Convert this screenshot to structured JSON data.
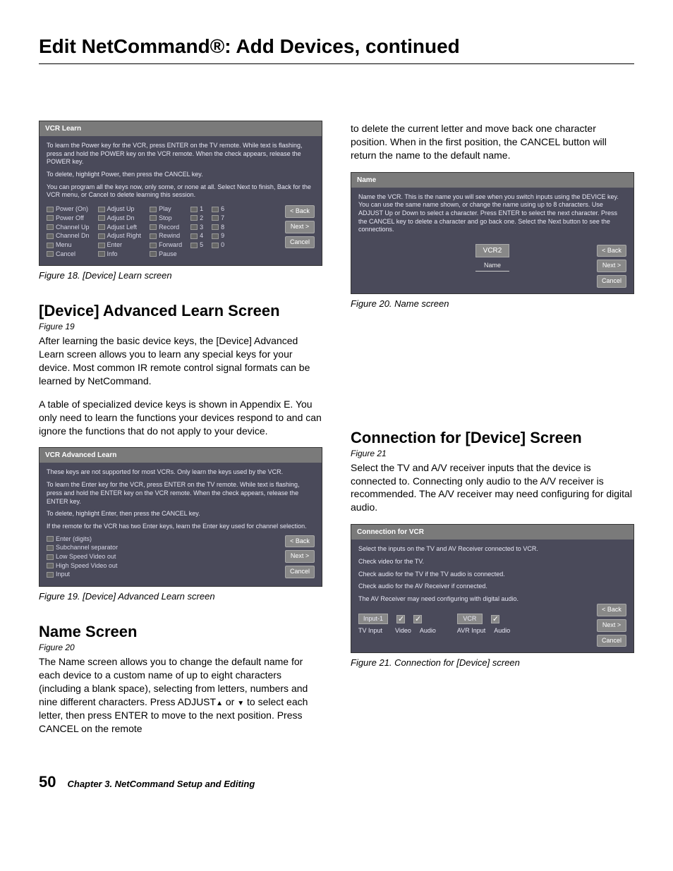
{
  "pageTitle": "Edit NetCommand®:  Add Devices, continued",
  "fig18": {
    "header": "VCR Learn",
    "instr1": "To learn the Power key for the VCR, press ENTER on the TV remote. While text is flashing, press and hold the POWER key on the VCR remote. When the check appears, release the POWER key.",
    "instr2": "To delete, highlight Power, then press the CANCEL key.",
    "instr3": "You can program all the keys now, only some, or none at all. Select Next to finish, Back for the VCR menu, or Cancel to delete learning this session.",
    "keysCol1": [
      "Power (On)",
      "Power Off",
      "Channel Up",
      "Channel Dn",
      "Menu",
      "Cancel"
    ],
    "keysCol2": [
      "Adjust Up",
      "Adjust Dn",
      "Adjust Left",
      "Adjust Right",
      "Enter",
      "Info"
    ],
    "keysCol3": [
      "Play",
      "Stop",
      "Record",
      "Rewind",
      "Forward",
      "Pause"
    ],
    "keysCol4": [
      "1",
      "2",
      "3",
      "4",
      "5"
    ],
    "keysCol5": [
      "6",
      "7",
      "8",
      "9",
      "0"
    ],
    "btnBack": "< Back",
    "btnNext": "Next >",
    "btnCancel": "Cancel",
    "caption": "Figure 18.  [Device] Learn screen"
  },
  "sectionAdvanced": {
    "title": "[Device] Advanced Learn Screen",
    "figref": "Figure 19",
    "p1": "After learning the basic device keys, the [Device] Advanced Learn screen allows you to learn any special keys for your device.  Most common IR remote control signal formats can be learned by NetCommand.",
    "p2": "A table of specialized device keys is shown in Appendix E. You only need to learn the functions your devices respond to and can ignore the functions that do not apply to your device."
  },
  "fig19": {
    "header": "VCR Advanced Learn",
    "instr1": "These keys are not supported for most VCRs. Only learn the keys used by the VCR.",
    "instr2": "To learn the Enter key for the VCR, press ENTER on the TV remote. While text is flashing, press and hold the ENTER key on the VCR remote. When the check appears, release the ENTER key.",
    "instr3": "To delete, highlight Enter, then press the CANCEL key.",
    "instr4": "If the remote for the VCR has two Enter keys, learn the Enter key used for channel selection.",
    "keys": [
      "Enter (digits)",
      "Subchannel separator",
      "Low Speed Video out",
      "High Speed Video out",
      "Input"
    ],
    "btnBack": "< Back",
    "btnNext": "Next >",
    "btnCancel": "Cancel",
    "caption": "Figure 19.  [Device] Advanced Learn screen"
  },
  "sectionName": {
    "title": "Name Screen",
    "figref": "Figure 20",
    "p1a": "The Name screen allows you to change the default name for each device to a custom name of up to eight characters (including a blank space), selecting from letters, numbers and nine different characters.  Press ADJUST",
    "p1b": " or ",
    "p1c": " to select each letter, then press ENTER to move to the next position.  Press CANCEL on the remote"
  },
  "rightTop": {
    "p": "to delete the current letter and move back one character position.  When in the first position, the CANCEL button will return the name to the default name."
  },
  "fig20": {
    "header": "Name",
    "instr": "Name the VCR.  This is the name you will see when you switch inputs using the DEVICE key.  You can use the same name shown, or change the name using up to 8 characters. Use ADJUST Up or Down to select a character.  Press ENTER to select the next character.  Press the CANCEL key to delete a character and go back one.  Select the Next button to see the connections.",
    "nameValue": "VCR2",
    "nameLabel": "Name",
    "btnBack": "< Back",
    "btnNext": "Next >",
    "btnCancel": "Cancel",
    "caption": "Figure 20.  Name screen"
  },
  "sectionConn": {
    "title": "Connection for [Device] Screen",
    "figref": "Figure 21",
    "p1": "Select the TV and A/V receiver inputs that the device is connected to.  Connecting only audio to the A/V receiver is recommended.  The A/V receiver may need configuring for digital audio."
  },
  "fig21": {
    "header": "Connection for VCR",
    "instr1": "Select the inputs on the TV and AV Receiver connected to VCR.",
    "instr2": "Check video for the TV.",
    "instr3": "Check audio for the TV if the TV audio is connected.",
    "instr4": "Check audio for the AV Receiver if connected.",
    "instr5": "The AV Receiver may need configuring with digital audio.",
    "tvInputVal": "Input-1",
    "tvInputLabel": "TV Input",
    "videoLabel": "Video",
    "audioLabel": "Audio",
    "avrInputVal": "VCR",
    "avrInputLabel": "AVR Input",
    "btnBack": "< Back",
    "btnNext": "Next >",
    "btnCancel": "Cancel",
    "caption": "Figure 21. Connection for [Device] screen"
  },
  "footer": {
    "pageNum": "50",
    "chapter": "Chapter 3.  NetCommand Setup and Editing"
  }
}
